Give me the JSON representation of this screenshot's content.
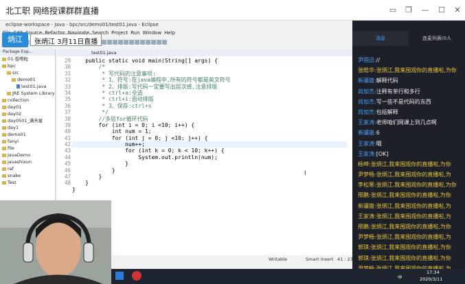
{
  "window": {
    "title": "北工职 网络授课群群直播"
  },
  "eclipse": {
    "title": "eclipse-workspace - Java - bpc/src/demo01/test01.java - Eclipse",
    "menu": [
      "File",
      "Edit",
      "Source",
      "Refactor",
      "Navigate",
      "Search",
      "Project",
      "Run",
      "Window",
      "Help"
    ],
    "banner": "张炳江 3月11日直播",
    "badge": "炳江",
    "explorer": {
      "header": "Package Exp...",
      "rows": [
        {
          "indent": 0,
          "icon": "folder",
          "label": "01-告吻粒"
        },
        {
          "indent": 0,
          "icon": "folder",
          "label": "bpc"
        },
        {
          "indent": 1,
          "icon": "folder",
          "label": "src"
        },
        {
          "indent": 2,
          "icon": "folder",
          "label": "demo01"
        },
        {
          "indent": 3,
          "icon": "java",
          "label": "test01.java"
        },
        {
          "indent": 1,
          "icon": "folder",
          "label": "JRE System Library"
        },
        {
          "indent": 0,
          "icon": "folder",
          "label": "collection"
        },
        {
          "indent": 0,
          "icon": "folder",
          "label": "day01"
        },
        {
          "indent": 0,
          "icon": "folder",
          "label": "day02"
        },
        {
          "indent": 0,
          "icon": "folder",
          "label": "day0501_满天星"
        },
        {
          "indent": 0,
          "icon": "folder",
          "label": "day1"
        },
        {
          "indent": 0,
          "icon": "folder",
          "label": "demo01"
        },
        {
          "indent": 0,
          "icon": "folder",
          "label": "fanyi"
        },
        {
          "indent": 0,
          "icon": "folder",
          "label": "file"
        },
        {
          "indent": 0,
          "icon": "folder",
          "label": "JavaDemo"
        },
        {
          "indent": 0,
          "icon": "folder",
          "label": "javashixun"
        },
        {
          "indent": 0,
          "icon": "folder",
          "label": "raf"
        },
        {
          "indent": 0,
          "icon": "folder",
          "label": "snake"
        },
        {
          "indent": 0,
          "icon": "folder",
          "label": "Test"
        }
      ]
    },
    "editor_tab": "test01.java",
    "line_numbers": [
      "29",
      "30",
      "31",
      "32",
      "33",
      "34",
      "35",
      "36",
      "37",
      "38",
      "39",
      "40",
      "41",
      "42",
      "43",
      "44",
      "45",
      "46",
      "47",
      "48"
    ],
    "code_lines": [
      "    public static void main(String[] args) {",
      "        /*",
      "         * 写代码的注意事项:",
      "         * 1、符号:在java编程中,所有的符号都是英文符号",
      "         * 2、排版:写代码一定要写出层次感,注意排版",
      "         * ctrl+a:全选",
      "         * ctrl+i:自动排版",
      "         * 3、保存:ctrl+s",
      "         */",
      "        //多层for循环代码",
      "        for (int i = 0; i <10; i++) {",
      "            int num = 1;",
      "            for (int j = 0; j <10; j++) {",
      "                num++;",
      "                for (int k = 0; k < 10; k++) {",
      "                    System.out.println(num);",
      "                }",
      "            }",
      "        }",
      "    }",
      "}"
    ],
    "status": {
      "mode": "Writable",
      "insert": "Smart Insert",
      "pos": "41 : 23"
    }
  },
  "chat": {
    "tabs": [
      "消息",
      "连麦列表(0人"
    ],
    "messages": [
      {
        "name": "尹固迅",
        "text": "//",
        "hl": false
      },
      {
        "name": "张皓华",
        "text": "张炳江,我来围观你的直播啦,为你",
        "hl": true
      },
      {
        "name": "新骧雄",
        "text": "解释代码",
        "hl": false
      },
      {
        "name": "尚加杰",
        "text": "注释有单行和多行",
        "hl": false
      },
      {
        "name": "尚加杰",
        "text": "写一些不是代码的东西",
        "hl": false
      },
      {
        "name": "尚加杰",
        "text": "包括解释",
        "hl": false
      },
      {
        "name": "王家涛",
        "text": "老师咱们网课上到几点啊",
        "hl": false
      },
      {
        "name": "新骧雄",
        "text": "6",
        "hl": false
      },
      {
        "name": "王家涛",
        "text": "哦",
        "hl": false
      },
      {
        "name": "王家涛",
        "text": "[OK]",
        "hl": false
      },
      {
        "name": "杨坤",
        "text": "张炳江,我来围观你的直播啦,为你",
        "hl": true
      },
      {
        "name": "尹梦畅",
        "text": "张炳江,我来围观你的直播啦,为",
        "hl": true
      },
      {
        "name": "李松寒",
        "text": "张炳江,我来围观你的直播啦,为你",
        "hl": true
      },
      {
        "name": "邢鹏",
        "text": "张炳江,我来围观你的直播啦,为你",
        "hl": true
      },
      {
        "name": "新骧雄",
        "text": "张炳江,我来围观你的直播啦,为",
        "hl": true
      },
      {
        "name": "王家涛",
        "text": "张炳江,我来围观你的直播啦,为",
        "hl": true
      },
      {
        "name": "邢鹏",
        "text": "张炳江,我来围观你的直播啦,为你",
        "hl": true
      },
      {
        "name": "尹梦畅",
        "text": "张炳江,我来围观你的直播啦,为",
        "hl": true
      },
      {
        "name": "郭琪",
        "text": "张炳江,我来围观你的直播啦,为你",
        "hl": true
      },
      {
        "name": "郭琪",
        "text": "张炳江,我来围观你的直播啦,为你",
        "hl": true
      },
      {
        "name": "尹梦畅",
        "text": "张炳江,我来围观你的直播啦,为",
        "hl": true
      },
      {
        "name": "邢鹏",
        "text": "张炳江,我来围观你的直播啦,为你",
        "hl": true
      }
    ]
  },
  "tray": {
    "ime": "中",
    "time": "17:34",
    "date": "2020/3/11"
  }
}
